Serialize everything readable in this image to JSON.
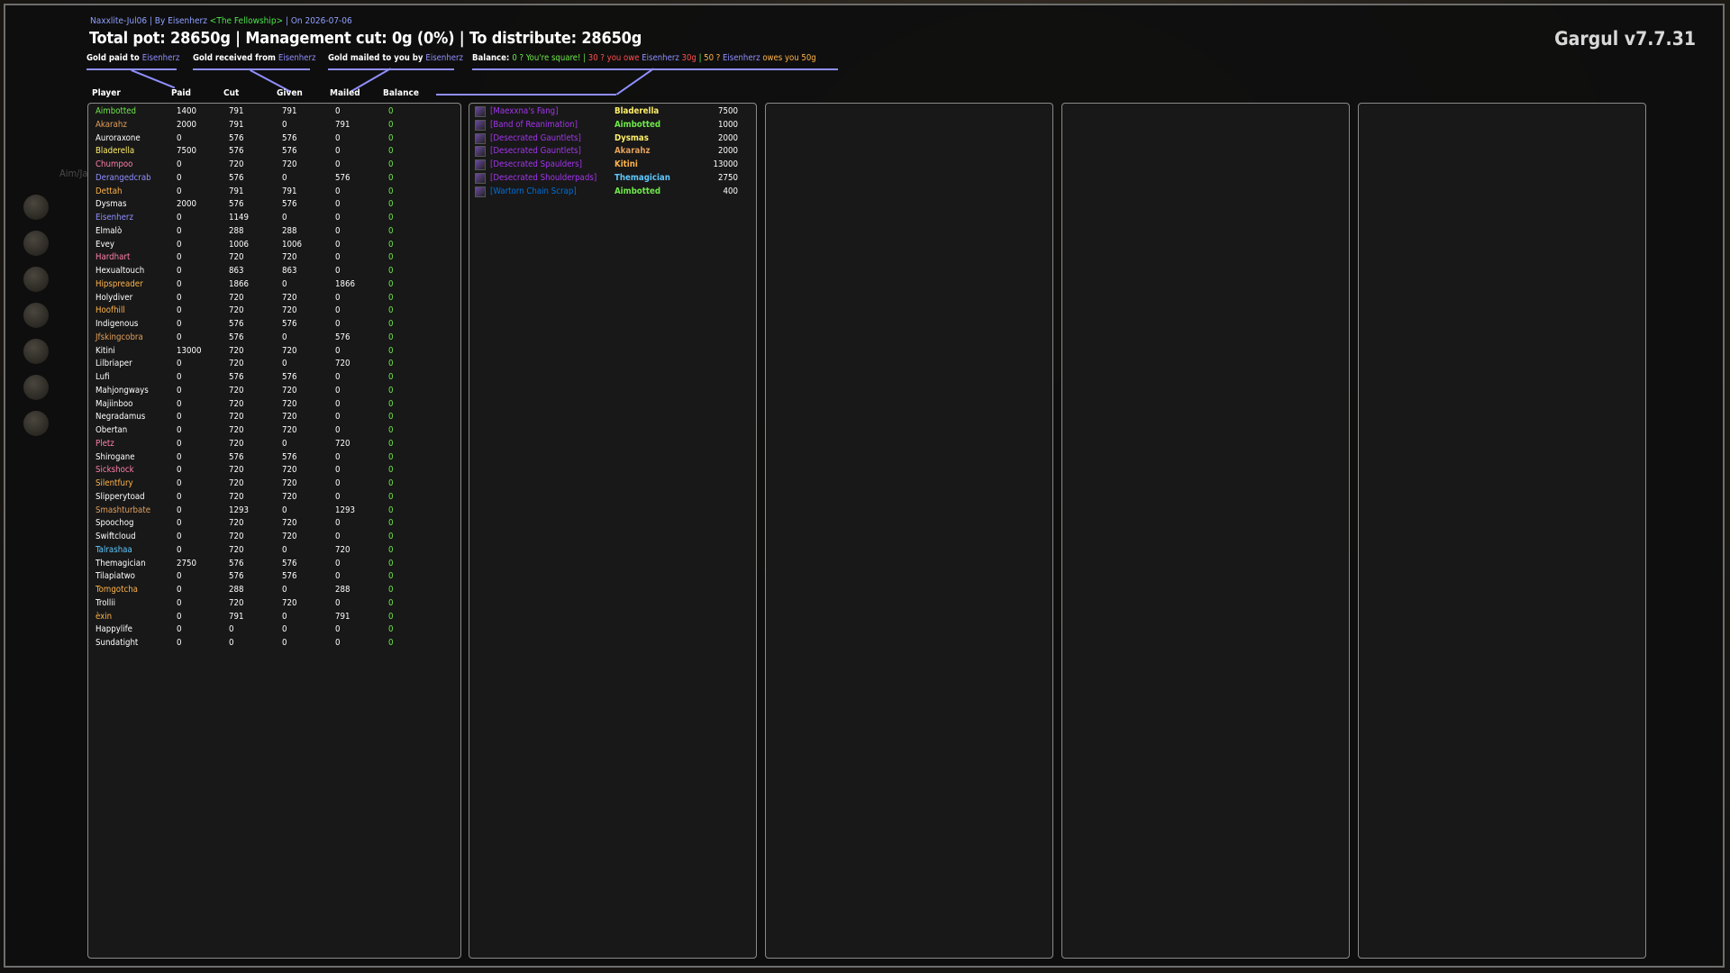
{
  "window": {
    "meta_left": "Naxxlite-Jul06 | By Eisenherz ",
    "meta_guild": "<The Fellowship>",
    "meta_right": " | On 2026-07-06",
    "headline": "Total pot: 28650g | Management cut: 0g (0%) | To distribute: 28650g",
    "brand": "Gargul v7.7.31"
  },
  "legend": {
    "paid_to_label": "Gold paid to ",
    "paid_to_name": "Eisenherz",
    "received_label": "Gold received from ",
    "received_name": "Eisenherz",
    "mailed_label": "Gold mailed to you by ",
    "mailed_name": "Eisenherz",
    "balance_label": "Balance: ",
    "balance_ok": "0 ? You're square!",
    "sep1": " | ",
    "balance_owe_a": "30 ? you owe ",
    "balance_owe_name": "Eisenherz",
    "balance_owe_b": " 30g",
    "sep2": " | ",
    "balance_owed_a": "50 ? ",
    "balance_owed_name": "Eisenherz",
    "balance_owed_b": " owes you 50g",
    "accent_color": "#8f8fff"
  },
  "columns": {
    "player": "Player",
    "paid": "Paid",
    "cut": "Cut",
    "given": "Given",
    "mailed": "Mailed",
    "balance": "Balance"
  },
  "players": [
    {
      "name": "Aimbotted",
      "paid": "1400",
      "cut": "791",
      "given": "791",
      "mailed": "0",
      "balance": "0",
      "color": "#6fe84a"
    },
    {
      "name": "Akarahz",
      "paid": "2000",
      "cut": "791",
      "given": "0",
      "mailed": "791",
      "balance": "0",
      "color": "#e3a05c"
    },
    {
      "name": "Auroraxone",
      "paid": "0",
      "cut": "576",
      "given": "576",
      "mailed": "0",
      "balance": "0",
      "color": "#ffffff"
    },
    {
      "name": "Bladerella",
      "paid": "7500",
      "cut": "576",
      "given": "576",
      "mailed": "0",
      "balance": "0",
      "color": "#fff06a"
    },
    {
      "name": "Chumpoo",
      "paid": "0",
      "cut": "720",
      "given": "720",
      "mailed": "0",
      "balance": "0",
      "color": "#ff7faa"
    },
    {
      "name": "Derangedcrab",
      "paid": "0",
      "cut": "576",
      "given": "0",
      "mailed": "576",
      "balance": "0",
      "color": "#8f8fff"
    },
    {
      "name": "Dettah",
      "paid": "0",
      "cut": "791",
      "given": "791",
      "mailed": "0",
      "balance": "0",
      "color": "#ffb44a"
    },
    {
      "name": "Dysmas",
      "paid": "2000",
      "cut": "576",
      "given": "576",
      "mailed": "0",
      "balance": "0",
      "color": "#ffffff"
    },
    {
      "name": "Eisenherz",
      "paid": "0",
      "cut": "1149",
      "given": "0",
      "mailed": "0",
      "balance": "0",
      "color": "#8f8fff"
    },
    {
      "name": "Elmalò",
      "paid": "0",
      "cut": "288",
      "given": "288",
      "mailed": "0",
      "balance": "0",
      "color": "#ffffff"
    },
    {
      "name": "Evey",
      "paid": "0",
      "cut": "1006",
      "given": "1006",
      "mailed": "0",
      "balance": "0",
      "color": "#ffffff"
    },
    {
      "name": "Hardhart",
      "paid": "0",
      "cut": "720",
      "given": "720",
      "mailed": "0",
      "balance": "0",
      "color": "#ff7faa"
    },
    {
      "name": "Hexualtouch",
      "paid": "0",
      "cut": "863",
      "given": "863",
      "mailed": "0",
      "balance": "0",
      "color": "#ffffff"
    },
    {
      "name": "Hipspreader",
      "paid": "0",
      "cut": "1866",
      "given": "0",
      "mailed": "1866",
      "balance": "0",
      "color": "#ffb44a"
    },
    {
      "name": "Holydiver",
      "paid": "0",
      "cut": "720",
      "given": "720",
      "mailed": "0",
      "balance": "0",
      "color": "#ffffff"
    },
    {
      "name": "Hoofhill",
      "paid": "0",
      "cut": "720",
      "given": "720",
      "mailed": "0",
      "balance": "0",
      "color": "#ffb44a"
    },
    {
      "name": "Indigenous",
      "paid": "0",
      "cut": "576",
      "given": "576",
      "mailed": "0",
      "balance": "0",
      "color": "#ffffff"
    },
    {
      "name": "Jfskingcobra",
      "paid": "0",
      "cut": "576",
      "given": "0",
      "mailed": "576",
      "balance": "0",
      "color": "#e3a05c"
    },
    {
      "name": "Kitini",
      "paid": "13000",
      "cut": "720",
      "given": "720",
      "mailed": "0",
      "balance": "0",
      "color": "#ffffff"
    },
    {
      "name": "Lilbriaper",
      "paid": "0",
      "cut": "720",
      "given": "0",
      "mailed": "720",
      "balance": "0",
      "color": "#ffffff"
    },
    {
      "name": "Lufi",
      "paid": "0",
      "cut": "576",
      "given": "576",
      "mailed": "0",
      "balance": "0",
      "color": "#ffffff"
    },
    {
      "name": "Mahjongways",
      "paid": "0",
      "cut": "720",
      "given": "720",
      "mailed": "0",
      "balance": "0",
      "color": "#ffffff"
    },
    {
      "name": "Majiinboo",
      "paid": "0",
      "cut": "720",
      "given": "720",
      "mailed": "0",
      "balance": "0",
      "color": "#ffffff"
    },
    {
      "name": "Negradamus",
      "paid": "0",
      "cut": "720",
      "given": "720",
      "mailed": "0",
      "balance": "0",
      "color": "#ffffff"
    },
    {
      "name": "Obertan",
      "paid": "0",
      "cut": "720",
      "given": "720",
      "mailed": "0",
      "balance": "0",
      "color": "#ffffff"
    },
    {
      "name": "Pletz",
      "paid": "0",
      "cut": "720",
      "given": "0",
      "mailed": "720",
      "balance": "0",
      "color": "#ff7faa"
    },
    {
      "name": "Shirogane",
      "paid": "0",
      "cut": "576",
      "given": "576",
      "mailed": "0",
      "balance": "0",
      "color": "#ffffff"
    },
    {
      "name": "Sickshock",
      "paid": "0",
      "cut": "720",
      "given": "720",
      "mailed": "0",
      "balance": "0",
      "color": "#ff7faa"
    },
    {
      "name": "Silentfury",
      "paid": "0",
      "cut": "720",
      "given": "720",
      "mailed": "0",
      "balance": "0",
      "color": "#ffb44a"
    },
    {
      "name": "Slipperytoad",
      "paid": "0",
      "cut": "720",
      "given": "720",
      "mailed": "0",
      "balance": "0",
      "color": "#ffffff"
    },
    {
      "name": "Smashturbate",
      "paid": "0",
      "cut": "1293",
      "given": "0",
      "mailed": "1293",
      "balance": "0",
      "color": "#e3a05c"
    },
    {
      "name": "Spoochog",
      "paid": "0",
      "cut": "720",
      "given": "720",
      "mailed": "0",
      "balance": "0",
      "color": "#ffffff"
    },
    {
      "name": "Swiftcloud",
      "paid": "0",
      "cut": "720",
      "given": "720",
      "mailed": "0",
      "balance": "0",
      "color": "#ffffff"
    },
    {
      "name": "Talrashaa",
      "paid": "0",
      "cut": "720",
      "given": "0",
      "mailed": "720",
      "balance": "0",
      "color": "#5fc8ff"
    },
    {
      "name": "Themagician",
      "paid": "2750",
      "cut": "576",
      "given": "576",
      "mailed": "0",
      "balance": "0",
      "color": "#ffffff"
    },
    {
      "name": "Tilapiatwo",
      "paid": "0",
      "cut": "576",
      "given": "576",
      "mailed": "0",
      "balance": "0",
      "color": "#ffffff"
    },
    {
      "name": "Tomgotcha",
      "paid": "0",
      "cut": "288",
      "given": "0",
      "mailed": "288",
      "balance": "0",
      "color": "#ffb44a"
    },
    {
      "name": "Trollii",
      "paid": "0",
      "cut": "720",
      "given": "720",
      "mailed": "0",
      "balance": "0",
      "color": "#ffffff"
    },
    {
      "name": "èxin",
      "paid": "0",
      "cut": "791",
      "given": "0",
      "mailed": "791",
      "balance": "0",
      "color": "#ffb44a"
    },
    {
      "name": "Happylife",
      "paid": "0",
      "cut": "0",
      "given": "0",
      "mailed": "0",
      "balance": "0",
      "color": "#ffffff"
    },
    {
      "name": "Sundatight",
      "paid": "0",
      "cut": "0",
      "given": "0",
      "mailed": "0",
      "balance": "0",
      "color": "#ffffff"
    }
  ],
  "loot": [
    {
      "item": "[Maexxna's Fang]",
      "winner": "Bladerella",
      "amount": "7500",
      "item_color": "#a335ee",
      "winner_color": "#fff06a"
    },
    {
      "item": "[Band of Reanimation]",
      "winner": "Aimbotted",
      "amount": "1000",
      "item_color": "#a335ee",
      "winner_color": "#6fe84a"
    },
    {
      "item": "[Desecrated Gauntlets]",
      "winner": "Dysmas",
      "amount": "2000",
      "item_color": "#a335ee",
      "winner_color": "#fff06a"
    },
    {
      "item": "[Desecrated Gauntlets]",
      "winner": "Akarahz",
      "amount": "2000",
      "item_color": "#a335ee",
      "winner_color": "#e3a05c"
    },
    {
      "item": "[Desecrated Spaulders]",
      "winner": "Kitini",
      "amount": "13000",
      "item_color": "#a335ee",
      "winner_color": "#ffb44a"
    },
    {
      "item": "[Desecrated Shoulderpads]",
      "winner": "Themagician",
      "amount": "2750",
      "item_color": "#a335ee",
      "winner_color": "#5fc8ff"
    },
    {
      "item": "[Wartorn Chain Scrap]",
      "winner": "Aimbotted",
      "amount": "400",
      "item_color": "#0070dd",
      "winner_color": "#6fe84a"
    }
  ]
}
